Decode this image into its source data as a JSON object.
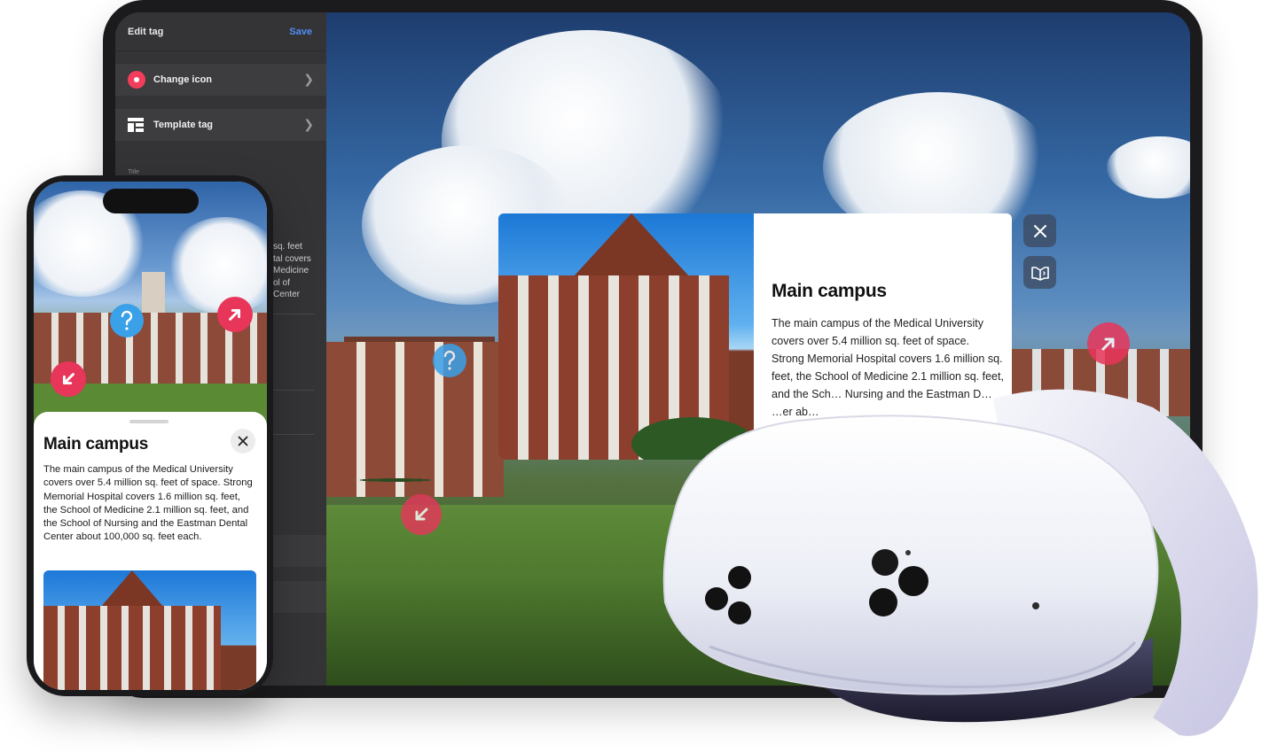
{
  "tablet": {
    "editor": {
      "title": "Edit tag",
      "save_label": "Save",
      "rows": [
        {
          "label": "Change icon",
          "icon": "record-icon"
        },
        {
          "label": "Template tag",
          "icon": "template-icon"
        }
      ],
      "section_label": "Title",
      "description_lines": [
        "sq. feet",
        "tal covers",
        "Medicine",
        "ol of",
        "Center"
      ]
    },
    "popup": {
      "title": "Main campus",
      "text": "The main campus of the Medical University covers over 5.4 million sq. feet of space. Strong Memorial Hospital covers 1.6 million sq. feet, the School of Medicine 2.1 million sq. feet, and the Sch… Nursing and the Eastman D… …er ab…"
    },
    "tags": [
      {
        "icon": "question-icon"
      },
      {
        "icon": "arrow-up-right-icon"
      },
      {
        "icon": "arrow-down-left-icon"
      }
    ],
    "side_buttons": [
      {
        "icon": "close-icon"
      },
      {
        "icon": "audio-book-icon"
      }
    ]
  },
  "phone": {
    "sheet": {
      "title": "Main campus",
      "text": "The main campus of the Medical University covers over 5.4 million sq. feet of space. Strong Memorial Hospital covers 1.6 million sq. feet, the School of Medicine 2.1 million sq. feet, and the School of Nursing and the Eastman Dental Center about 100,000 sq. feet each."
    },
    "tags": [
      {
        "icon": "question-icon"
      },
      {
        "icon": "arrow-up-right-icon"
      },
      {
        "icon": "arrow-down-left-icon"
      }
    ]
  },
  "colors": {
    "accent_blue": "#3aa0e8",
    "accent_red": "#e8355a",
    "save_blue": "#4f8ff7",
    "panel_dark": "#343436"
  }
}
